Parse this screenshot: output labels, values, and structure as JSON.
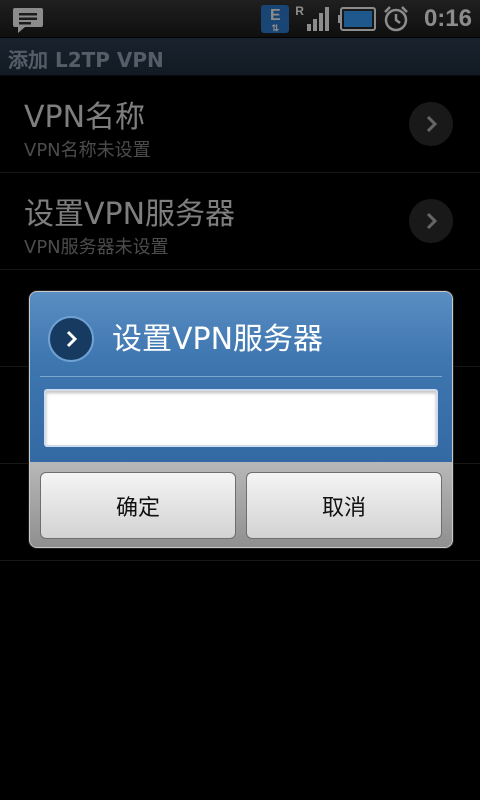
{
  "status_bar": {
    "time": "0:16",
    "network_letter": "E",
    "roaming_letter": "R",
    "icons": [
      "message-icon",
      "network-e-icon",
      "signal-icon",
      "battery-icon",
      "alarm-icon"
    ]
  },
  "title_bar": {
    "title": "添加 L2TP VPN"
  },
  "list": {
    "items": [
      {
        "title": "VPN名称",
        "subtitle": "VPN名称未设置"
      },
      {
        "title": "设置VPN服务器",
        "subtitle": "VPN服务器未设置"
      },
      {
        "title": "",
        "subtitle": ""
      },
      {
        "title": "",
        "subtitle": ""
      },
      {
        "title": "",
        "subtitle": ""
      }
    ]
  },
  "dialog": {
    "title": "设置VPN服务器",
    "input_value": "",
    "ok_label": "确定",
    "cancel_label": "取消"
  },
  "colors": {
    "dialog_header": "#3e76b0",
    "list_background": "#000000",
    "battery_fill": "#3aa0ff"
  }
}
